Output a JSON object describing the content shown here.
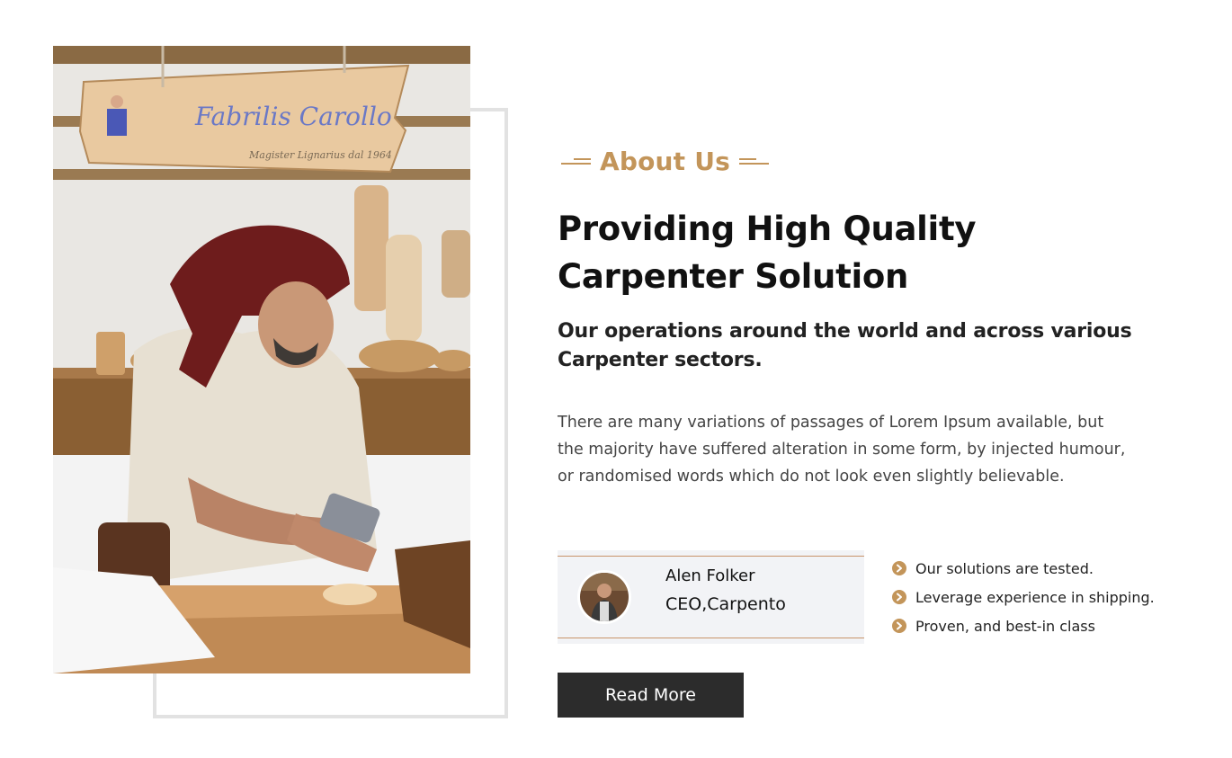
{
  "about": {
    "tagline": "About Us",
    "heading": "Providing High Quality Carpenter Solution",
    "subheading": "Our operations around the world and across various Carpenter sectors.",
    "paragraph": "There are many variations of passages of Lorem Ipsum available, but the majority have suffered alteration in some form, by injected humour, or randomised words which do not look even slightly believable.",
    "accent_color": "#c3955a"
  },
  "sign": {
    "line1": "Fabrilis Carollo",
    "line2": "Magister Lignarius dal 1964"
  },
  "profile": {
    "name": "Alen Folker",
    "role": "CEO,Carpento"
  },
  "features": [
    "Our solutions are tested.",
    "Leverage experience in shipping.",
    "Proven, and best-in class"
  ],
  "feature_icon": "chevron-circle-right-icon",
  "cta": {
    "label": "Read More"
  }
}
